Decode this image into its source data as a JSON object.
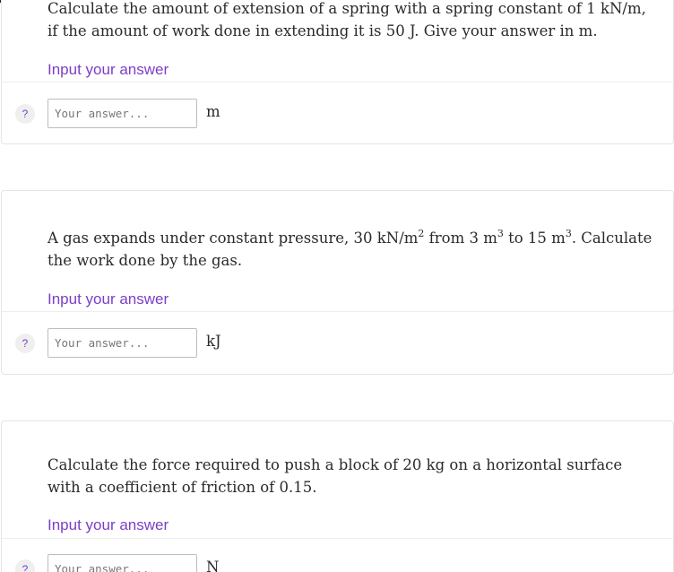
{
  "questions": [
    {
      "text_line1": "Calculate the amount of extension of a spring with a spring constant of 1 kN/m,",
      "text_line2": "if the amount of work done in extending it is 50 J. Give your answer in m.",
      "input_label": "Input your answer",
      "placeholder": "Your answer...",
      "unit": "m",
      "help": "?"
    },
    {
      "text_line1_a": "A gas expands under constant pressure, 30 kN/m",
      "text_line1_sup1": "2",
      "text_line1_b": " from 3 m",
      "text_line1_sup2": "3",
      "text_line1_c": " to 15 m",
      "text_line1_sup3": "3",
      "text_line1_d": ". Calculate",
      "text_line2": "the work done by the gas.",
      "input_label": "Input your answer",
      "placeholder": "Your answer...",
      "unit": "kJ",
      "help": "?"
    },
    {
      "text_line1": "Calculate the force required to push a block of 20 kg on a horizontal surface",
      "text_line2": "with a coefficient of friction of 0.15.",
      "input_label": "Input your answer",
      "placeholder": "Your answer...",
      "unit": "N",
      "help": "?"
    }
  ]
}
